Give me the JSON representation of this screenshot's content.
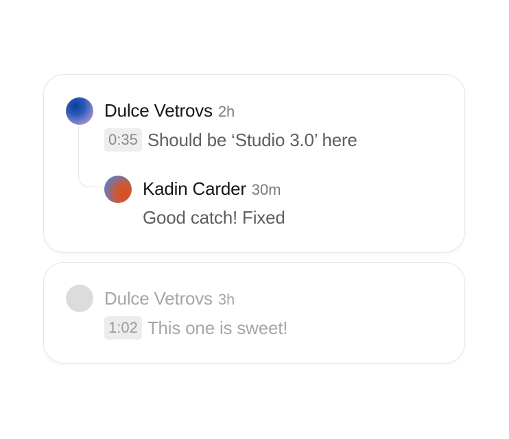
{
  "threads": [
    {
      "comment": {
        "author": "Dulce Vetrovs",
        "time": "2h",
        "timestamp": "0:35",
        "text": "Should be ‘Studio 3.0’ here"
      },
      "reply": {
        "author": "Kadin Carder",
        "time": "30m",
        "text": "Good catch! Fixed"
      }
    },
    {
      "comment": {
        "author": "Dulce Vetrovs",
        "time": "3h",
        "timestamp": "1:02",
        "text": "This one is sweet!"
      }
    }
  ],
  "colors": {
    "card_border": "#e6e6e6",
    "name": "#161616",
    "message": "#5e5e5e",
    "muted": "#a6a6a6",
    "stamp_bg": "#eeeeee"
  },
  "icons": {
    "avatar_dulce": "avatar-gradient-blue",
    "avatar_kadin": "avatar-gradient-orange",
    "avatar_placeholder": "avatar-placeholder"
  }
}
